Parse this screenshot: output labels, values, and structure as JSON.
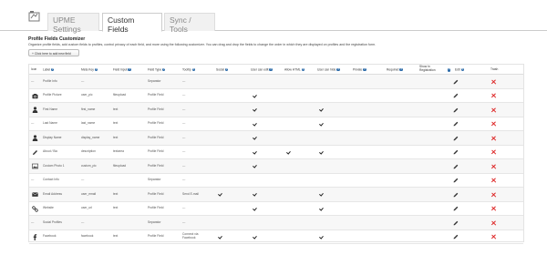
{
  "tabs": [
    "UPME Settings",
    "Custom Fields",
    "Sync / Tools"
  ],
  "page": {
    "title": "Profile Fields Customizer",
    "description": "Organize profile fields, add custom fields to profiles, control privacy of each field, and more using the following customizer. You can drag and drop the fields to change the order in which they are displayed on profiles and the registration form.",
    "add_button": "+ Click here to add new field"
  },
  "columns": [
    "Icon",
    "Label",
    "Meta Key",
    "Field Input",
    "Field Type",
    "Tooltip",
    "Social",
    "User can edit",
    "Allow HTML",
    "User can hide",
    "Private",
    "Required",
    "Show in Registration",
    "Edit",
    "Trash"
  ],
  "rows": [
    {
      "icon": "none",
      "label": "Profile Info",
      "meta": "---",
      "input": "",
      "type": "Separator",
      "tooltip": "---",
      "social": false,
      "edit": false,
      "html": false,
      "hide": false
    },
    {
      "icon": "camera-icon",
      "label": "Profile Picture",
      "meta": "user_pic",
      "input": "fileupload",
      "type": "Profile Field",
      "tooltip": "---",
      "social": false,
      "edit": true,
      "html": false,
      "hide": false
    },
    {
      "icon": "user-icon",
      "label": "First Name",
      "meta": "first_name",
      "input": "text",
      "type": "Profile Field",
      "tooltip": "---",
      "social": false,
      "edit": true,
      "html": false,
      "hide": true
    },
    {
      "icon": "none",
      "label": "Last Name",
      "meta": "last_name",
      "input": "text",
      "type": "Profile Field",
      "tooltip": "---",
      "social": false,
      "edit": true,
      "html": false,
      "hide": true
    },
    {
      "icon": "user-icon",
      "label": "Display Name",
      "meta": "display_name",
      "input": "text",
      "type": "Profile Field",
      "tooltip": "---",
      "social": false,
      "edit": true,
      "html": false,
      "hide": false
    },
    {
      "icon": "pencil-icon",
      "label": "About / Bio",
      "meta": "description",
      "input": "textarea",
      "type": "Profile Field",
      "tooltip": "---",
      "social": false,
      "edit": true,
      "html": true,
      "hide": true
    },
    {
      "icon": "picture-icon",
      "label": "Custom Photo 1",
      "meta": "custom_pic",
      "input": "fileupload",
      "type": "Profile Field",
      "tooltip": "---",
      "social": false,
      "edit": true,
      "html": false,
      "hide": false
    },
    {
      "icon": "none",
      "label": "Contact Info",
      "meta": "---",
      "input": "",
      "type": "Separator",
      "tooltip": "---",
      "social": false,
      "edit": false,
      "html": false,
      "hide": false
    },
    {
      "icon": "envelope-icon",
      "label": "Email Address",
      "meta": "user_email",
      "input": "text",
      "type": "Profile Field",
      "tooltip": "Send E-mail",
      "social": true,
      "edit": true,
      "html": false,
      "hide": true
    },
    {
      "icon": "link-icon",
      "label": "Website",
      "meta": "user_url",
      "input": "text",
      "type": "Profile Field",
      "tooltip": "---",
      "social": false,
      "edit": true,
      "html": false,
      "hide": true
    },
    {
      "icon": "none",
      "label": "Social Profiles",
      "meta": "---",
      "input": "",
      "type": "Separator",
      "tooltip": "---",
      "social": false,
      "edit": false,
      "html": false,
      "hide": false
    },
    {
      "icon": "facebook-icon",
      "label": "Facebook",
      "meta": "facebook",
      "input": "text",
      "type": "Profile Field",
      "tooltip": "Connect via Facebook",
      "social": true,
      "edit": true,
      "html": false,
      "hide": true
    }
  ],
  "row_placeholder": "---"
}
